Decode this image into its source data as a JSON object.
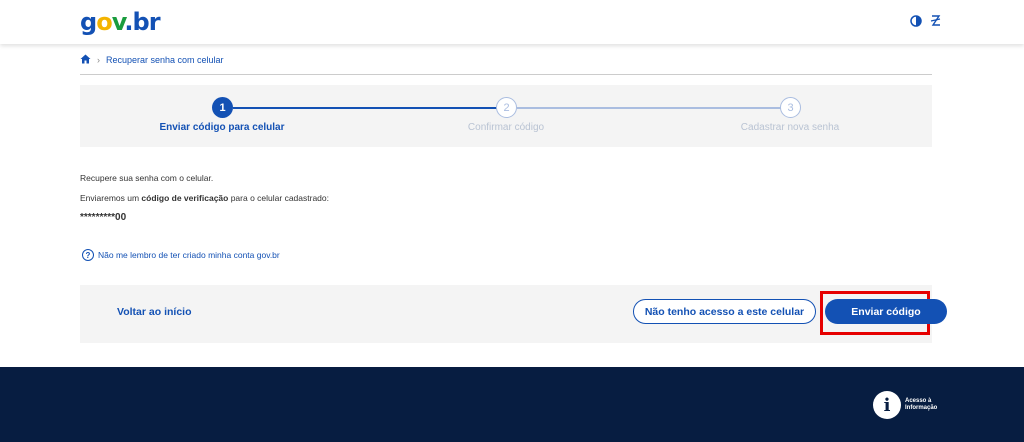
{
  "header": {
    "logo": {
      "g": "g",
      "o": "o",
      "v": "v",
      "dot": ".",
      "b": "b",
      "r": "r"
    },
    "icons": [
      "contrast-icon",
      "accessibility-icon"
    ]
  },
  "breadcrumb": {
    "home_icon": "home-icon",
    "current": "Recuperar senha com celular"
  },
  "stepper": {
    "steps": [
      {
        "number": "1",
        "label": "Enviar código para celular",
        "state": "active"
      },
      {
        "number": "2",
        "label": "Confirmar código",
        "state": "pending"
      },
      {
        "number": "3",
        "label": "Cadastrar nova senha",
        "state": "pending"
      }
    ]
  },
  "content": {
    "line1": "Recupere sua senha com o celular.",
    "line2_prefix": "Enviaremos um ",
    "line2_bold": "código de verificação",
    "line2_suffix": " para o celular cadastrado:",
    "masked_phone": "*********00",
    "help_text": "Não me lembro de ter criado minha conta gov.br"
  },
  "actions": {
    "back_label": "Voltar ao início",
    "no_access_label": "Não tenho acesso a este celular",
    "send_label": "Enviar código"
  },
  "footer": {
    "badge_line1": "Acesso à",
    "badge_line2": "Informação"
  },
  "colors": {
    "primary": "#1351b4",
    "footer_bg": "#071d41",
    "highlight": "#e60000"
  }
}
